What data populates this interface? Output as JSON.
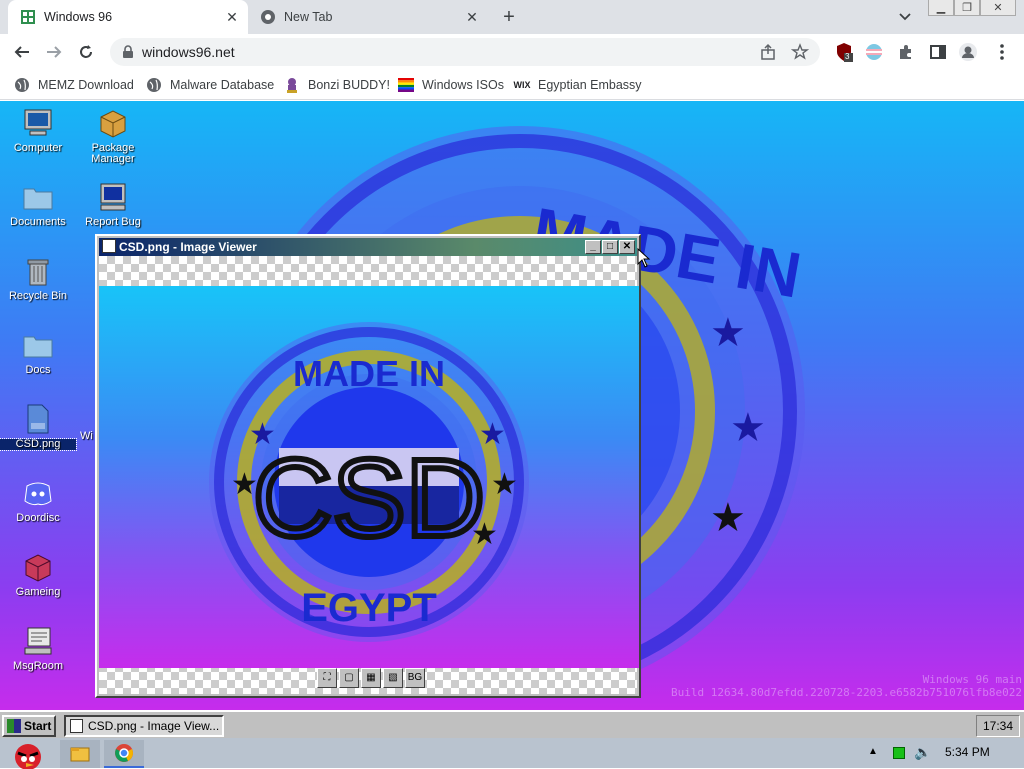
{
  "browser": {
    "tabs": [
      {
        "title": "Windows 96",
        "active": true
      },
      {
        "title": "New Tab",
        "active": false
      }
    ],
    "address": "windows96.net",
    "extension_badge": "3",
    "bookmarks": [
      {
        "label": "MEMZ Download",
        "icon": "globe-icon"
      },
      {
        "label": "Malware Database",
        "icon": "globe-icon"
      },
      {
        "label": "Bonzi BUDDY!",
        "icon": "bonzi-icon"
      },
      {
        "label": "Windows ISOs",
        "icon": "rainbow-flag-icon"
      },
      {
        "label": "Egyptian Embassy",
        "icon": "wix-icon"
      }
    ]
  },
  "desktop": {
    "icons": [
      {
        "label": "Computer"
      },
      {
        "label": "Package Manager"
      },
      {
        "label": "Documents"
      },
      {
        "label": "Report Bug"
      },
      {
        "label": "Recycle Bin"
      },
      {
        "label": "Docs"
      },
      {
        "label": "CSD.png",
        "selected": true
      },
      {
        "label": "Doordisc"
      },
      {
        "label": "Gameing"
      },
      {
        "label": "MsgRoom"
      }
    ],
    "partial_label": "Wi",
    "build_line1": "Windows 96 main",
    "build_line2": "Build 12634.80d7efdd.220728-2203.e6582b751076lfb8e022"
  },
  "seal": {
    "top_text": "MADE IN",
    "center_text": "CSD",
    "bottom_text": "EGYPT"
  },
  "viewer": {
    "title": "CSD.png - Image Viewer",
    "tools": [
      "⛶",
      "▢",
      "▦",
      "▧",
      "BG"
    ]
  },
  "win96_taskbar": {
    "start_label": "Start",
    "task_label": "CSD.png - Image View...",
    "clock": "17:34"
  },
  "host_taskbar": {
    "clock": "5:34 PM"
  },
  "colors": {
    "desktop_top": "#16b6f6",
    "desktop_bottom": "#c62cec",
    "title_bar": "#0a246a"
  }
}
